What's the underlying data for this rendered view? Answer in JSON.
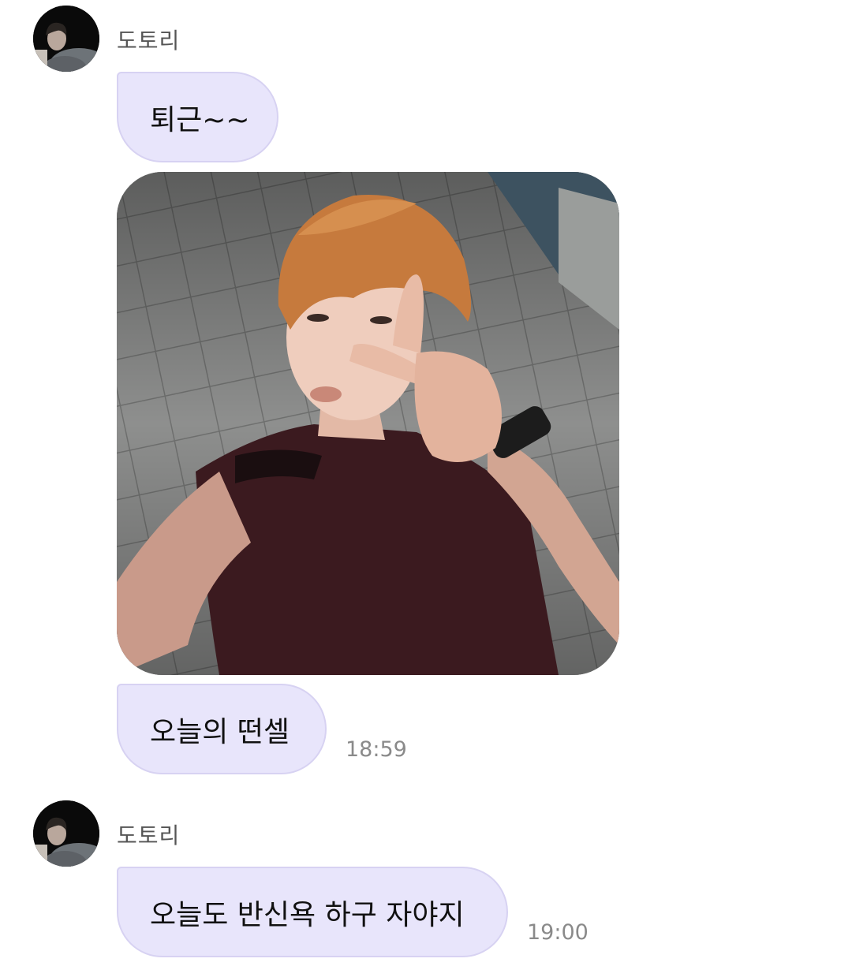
{
  "chat": {
    "groups": [
      {
        "sender": "도토리",
        "avatar_icon": "profile-photo",
        "messages": [
          {
            "type": "text",
            "text": "퇴근~~"
          },
          {
            "type": "image",
            "icon": "selfie-photo"
          },
          {
            "type": "text",
            "text": "오늘의 떤셀",
            "time": "18:59"
          }
        ]
      },
      {
        "sender": "도토리",
        "avatar_icon": "profile-photo",
        "messages": [
          {
            "type": "text",
            "text": "오늘도 반신욕 하구 자야지",
            "time": "19:00"
          }
        ]
      }
    ]
  },
  "colors": {
    "bubble_bg": "#e8e5fb",
    "bubble_border": "#d7d2f2",
    "sender_name": "#555555",
    "timestamp": "#8a8a8a"
  }
}
